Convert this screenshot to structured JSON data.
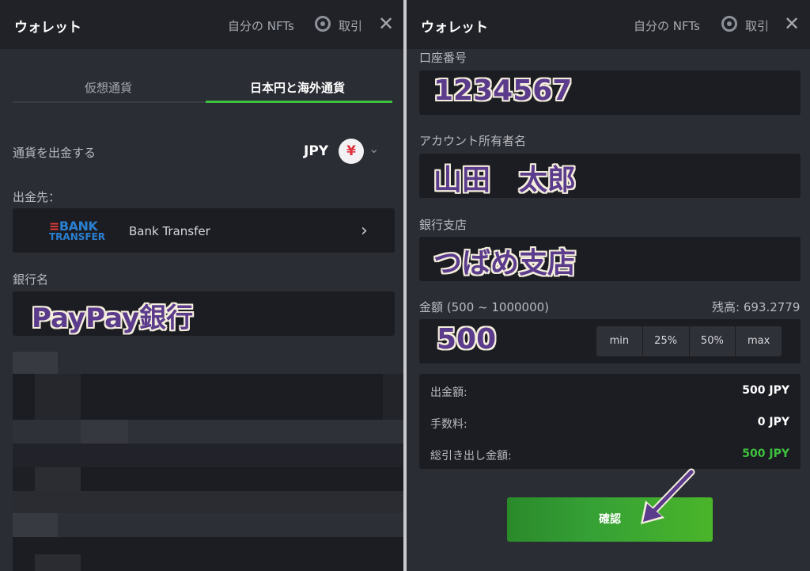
{
  "header": {
    "title": "ウォレット",
    "nfts_label": "自分の NFTs",
    "trade_label": "取引",
    "close_symbol": "✕"
  },
  "left": {
    "tabs": [
      {
        "label": "仮想通貨",
        "active": false
      },
      {
        "label": "日本円と海外通貨",
        "active": true
      }
    ],
    "withdraw_currency_label": "通貨を出金する",
    "currency": "JPY",
    "currency_symbol": "¥",
    "destination_label": "出金先：",
    "bank_logo_top": "BANK",
    "bank_logo_bottom": "TRANSFER",
    "bank_method": "Bank Transfer",
    "bank_name_label": "銀行名",
    "bank_name_value": "PayPay銀行"
  },
  "right": {
    "account_number_label": "口座番号",
    "account_number_value": "1234567",
    "account_holder_label": "アカウント所有者名",
    "account_holder_value": "山田　太郎",
    "branch_label": "銀行支店",
    "branch_value": "つばめ支店",
    "amount_label": "金額 (500 ~ 1000000)",
    "balance_label": "残高: 693.2779",
    "amount_value": "500",
    "presets": [
      "min",
      "25%",
      "50%",
      "max"
    ],
    "summary": {
      "withdraw_label": "出金額:",
      "withdraw_value": "500 JPY",
      "fee_label": "手数料:",
      "fee_value": "0 JPY",
      "total_label": "総引き出し金額:",
      "total_value": "500 JPY"
    },
    "confirm_label": "確認"
  },
  "colors": {
    "accent_green": "#3ec13e",
    "total_green": "#3ec13e",
    "annotation_purple": "#5b3b8c"
  }
}
